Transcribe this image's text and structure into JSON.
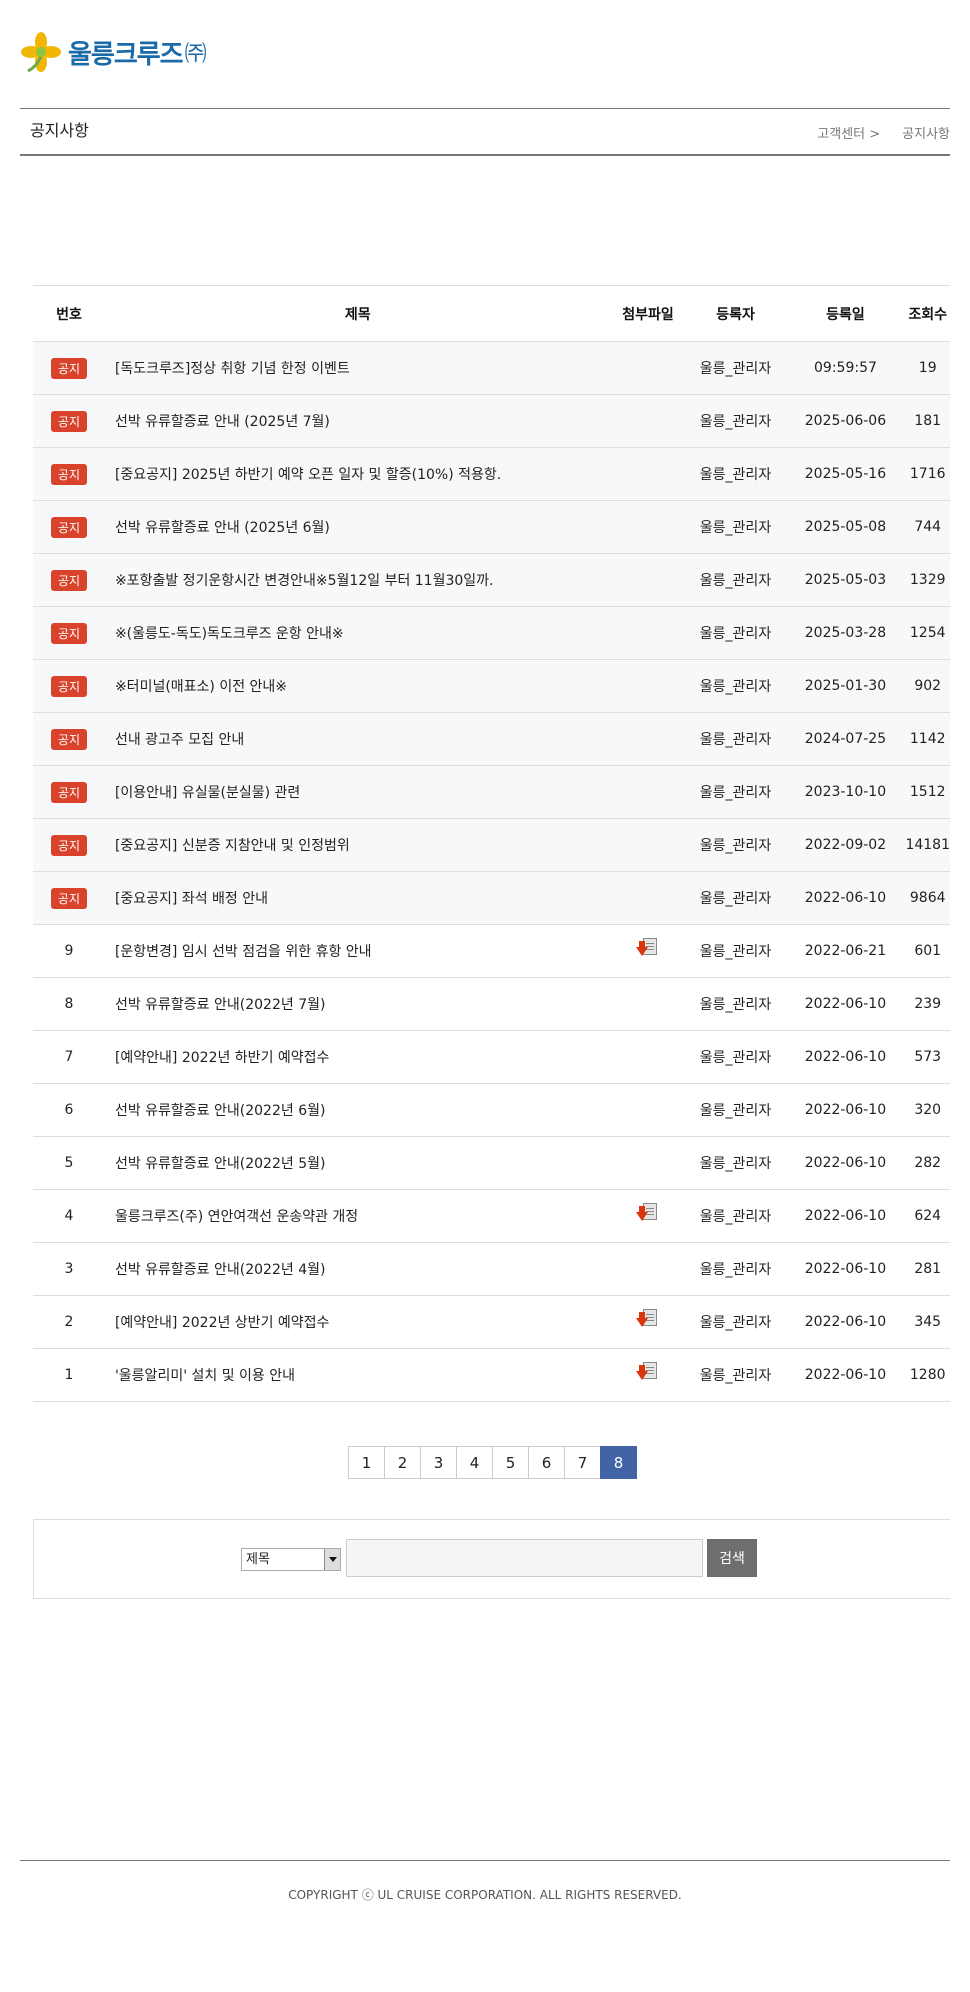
{
  "logo": {
    "name": "울릉크루즈",
    "suffix": "㈜"
  },
  "header": {
    "title": "공지사항",
    "breadcrumb": [
      "고객센터 >",
      "공지사항"
    ]
  },
  "table": {
    "columns": [
      "번호",
      "제목",
      "첨부파일",
      "등록자",
      "등록일",
      "조회수"
    ],
    "notice_label": "공지",
    "rows": [
      {
        "no": "공지",
        "title": "[독도크루즈]정상 취항 기념 한정 이벤트",
        "attach": false,
        "author": "울릉_관리자",
        "date": "09:59:57",
        "views": "19"
      },
      {
        "no": "공지",
        "title": "선박 유류할증료 안내 (2025년 7월)",
        "attach": false,
        "author": "울릉_관리자",
        "date": "2025-06-06",
        "views": "181"
      },
      {
        "no": "공지",
        "title": "[중요공지] 2025년 하반기 예약 오픈 일자 및 할증(10%) 적용항.",
        "attach": false,
        "author": "울릉_관리자",
        "date": "2025-05-16",
        "views": "1716"
      },
      {
        "no": "공지",
        "title": "선박 유류할증료 안내 (2025년 6월)",
        "attach": false,
        "author": "울릉_관리자",
        "date": "2025-05-08",
        "views": "744"
      },
      {
        "no": "공지",
        "title": "※포항출발 정기운항시간 변경안내※5월12일 부터 11월30일까.",
        "attach": false,
        "author": "울릉_관리자",
        "date": "2025-05-03",
        "views": "1329"
      },
      {
        "no": "공지",
        "title": "※(울릉도-독도)독도크루즈 운항 안내※",
        "attach": false,
        "author": "울릉_관리자",
        "date": "2025-03-28",
        "views": "1254"
      },
      {
        "no": "공지",
        "title": "※터미널(매표소) 이전 안내※",
        "attach": false,
        "author": "울릉_관리자",
        "date": "2025-01-30",
        "views": "902"
      },
      {
        "no": "공지",
        "title": "선내 광고주 모집 안내",
        "attach": false,
        "author": "울릉_관리자",
        "date": "2024-07-25",
        "views": "1142"
      },
      {
        "no": "공지",
        "title": "[이용안내] 유실물(분실물) 관련",
        "attach": false,
        "author": "울릉_관리자",
        "date": "2023-10-10",
        "views": "1512"
      },
      {
        "no": "공지",
        "title": "[중요공지] 신분증 지참안내 및 인정범위",
        "attach": false,
        "author": "울릉_관리자",
        "date": "2022-09-02",
        "views": "14181"
      },
      {
        "no": "공지",
        "title": "[중요공지] 좌석 배정 안내",
        "attach": false,
        "author": "울릉_관리자",
        "date": "2022-06-10",
        "views": "9864"
      },
      {
        "no": "9",
        "title": "[운항변경] 임시 선박 점검을 위한 휴항 안내",
        "attach": true,
        "author": "울릉_관리자",
        "date": "2022-06-21",
        "views": "601"
      },
      {
        "no": "8",
        "title": "선박 유류할증료 안내(2022년 7월)",
        "attach": false,
        "author": "울릉_관리자",
        "date": "2022-06-10",
        "views": "239"
      },
      {
        "no": "7",
        "title": "[예약안내] 2022년 하반기 예약접수",
        "attach": false,
        "author": "울릉_관리자",
        "date": "2022-06-10",
        "views": "573"
      },
      {
        "no": "6",
        "title": "선박 유류할증료 안내(2022년 6월)",
        "attach": false,
        "author": "울릉_관리자",
        "date": "2022-06-10",
        "views": "320"
      },
      {
        "no": "5",
        "title": "선박 유류할증료 안내(2022년 5월)",
        "attach": false,
        "author": "울릉_관리자",
        "date": "2022-06-10",
        "views": "282"
      },
      {
        "no": "4",
        "title": "울릉크루즈(주) 연안여객선 운송약관 개정",
        "attach": true,
        "author": "울릉_관리자",
        "date": "2022-06-10",
        "views": "624"
      },
      {
        "no": "3",
        "title": "선박 유류할증료 안내(2022년 4월)",
        "attach": false,
        "author": "울릉_관리자",
        "date": "2022-06-10",
        "views": "281"
      },
      {
        "no": "2",
        "title": "[예약안내] 2022년 상반기 예약접수",
        "attach": true,
        "author": "울릉_관리자",
        "date": "2022-06-10",
        "views": "345"
      },
      {
        "no": "1",
        "title": "'울릉알리미' 설치 및 이용 안내",
        "attach": true,
        "author": "울릉_관리자",
        "date": "2022-06-10",
        "views": "1280"
      }
    ]
  },
  "pagination": {
    "pages": [
      "1",
      "2",
      "3",
      "4",
      "5",
      "6",
      "7",
      "8"
    ],
    "active": "8"
  },
  "search": {
    "select_value": "제목",
    "input_value": "",
    "button_label": "검색"
  },
  "footer": {
    "copyright": "COPYRIGHT ⓒ UL CRUISE CORPORATION. ALL RIGHTS RESERVED."
  },
  "colors": {
    "brand": "#1b6aa8",
    "notice_badge": "#d9432c",
    "active_page": "#4263a6",
    "search_button": "#6c6e70"
  }
}
